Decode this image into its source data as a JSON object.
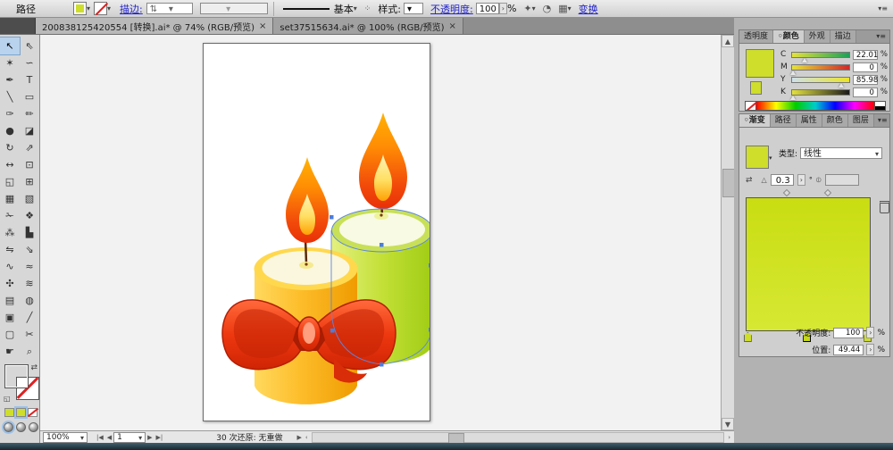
{
  "control_bar": {
    "context_label": "路径",
    "stroke_label": "描边:",
    "brush_value": "基本",
    "style_label": "样式:",
    "opacity_label": "不透明度:",
    "opacity_value": "100",
    "percent": "%",
    "transform_label": "变换",
    "icons": [
      {
        "name": "select-similar-icon",
        "glyph": "✦"
      },
      {
        "name": "document-setup-icon",
        "glyph": "◔"
      },
      {
        "name": "artboard-grid-icon",
        "glyph": "▦"
      }
    ]
  },
  "tabs": [
    {
      "title": "200838125420554 [转换].ai* @ 74% (RGB/预览)",
      "close": "×"
    },
    {
      "title": "set37515634.ai* @ 100% (RGB/预览)",
      "close": "×"
    }
  ],
  "tools": [
    {
      "name": "selection-tool",
      "glyph": "↖"
    },
    {
      "name": "direct-selection-tool",
      "glyph": "⇖"
    },
    {
      "name": "magic-wand-tool",
      "glyph": "✶"
    },
    {
      "name": "lasso-tool",
      "glyph": "∽"
    },
    {
      "name": "pen-tool",
      "glyph": "✒"
    },
    {
      "name": "type-tool",
      "glyph": "T"
    },
    {
      "name": "line-segment-tool",
      "glyph": "╲"
    },
    {
      "name": "rectangle-tool",
      "glyph": "▭"
    },
    {
      "name": "paintbrush-tool",
      "glyph": "✑"
    },
    {
      "name": "pencil-tool",
      "glyph": "✏"
    },
    {
      "name": "blob-brush-tool",
      "glyph": "●"
    },
    {
      "name": "eraser-tool",
      "glyph": "◪"
    },
    {
      "name": "rotate-tool",
      "glyph": "↻"
    },
    {
      "name": "scale-tool",
      "glyph": "⇗"
    },
    {
      "name": "width-tool",
      "glyph": "↔"
    },
    {
      "name": "free-transform-tool",
      "glyph": "⊡"
    },
    {
      "name": "shape-builder-tool",
      "glyph": "◱"
    },
    {
      "name": "perspective-grid-tool",
      "glyph": "⊞"
    },
    {
      "name": "mesh-tool",
      "glyph": "▦"
    },
    {
      "name": "gradient-tool",
      "glyph": "▧"
    },
    {
      "name": "eyedropper-tool",
      "glyph": "✁"
    },
    {
      "name": "blend-tool",
      "glyph": "❖"
    },
    {
      "name": "symbol-sprayer-tool",
      "glyph": "⁂"
    },
    {
      "name": "column-graph-tool",
      "glyph": "▙"
    },
    {
      "name": "reflect-tool",
      "glyph": "⇋"
    },
    {
      "name": "shear-tool",
      "glyph": "⇘"
    },
    {
      "name": "reshape-tool",
      "glyph": "∿"
    },
    {
      "name": "smooth-tool",
      "glyph": "≈"
    },
    {
      "name": "crystallize-tool",
      "glyph": "✣"
    },
    {
      "name": "wrinkle-tool",
      "glyph": "≋"
    },
    {
      "name": "envelope-mesh-tool",
      "glyph": "▤"
    },
    {
      "name": "live-paint-bucket-tool",
      "glyph": "◍"
    },
    {
      "name": "live-paint-selection-tool",
      "glyph": "▣"
    },
    {
      "name": "knife-tool",
      "glyph": "╱"
    },
    {
      "name": "artboard-tool",
      "glyph": "▢"
    },
    {
      "name": "slice-tool",
      "glyph": "✂"
    },
    {
      "name": "hand-tool",
      "glyph": "☛"
    },
    {
      "name": "zoom-tool",
      "glyph": "⌕"
    }
  ],
  "toolbox": {
    "fill_color": "#cede2b"
  },
  "color_panel": {
    "tabs": [
      "透明度",
      "颜色",
      "外观",
      "描边"
    ],
    "active_tab": "颜色",
    "swatch_color": "#cede2b",
    "channels": [
      {
        "label": "C",
        "value": "22.01",
        "pos": 22
      },
      {
        "label": "M",
        "value": "0",
        "pos": 2
      },
      {
        "label": "Y",
        "value": "85.98",
        "pos": 86
      },
      {
        "label": "K",
        "value": "0",
        "pos": 2
      }
    ],
    "unit": "%"
  },
  "gradient_panel": {
    "tabs": [
      "渐变",
      "路径",
      "属性",
      "颜色",
      "图层"
    ],
    "active_tab": "渐变",
    "type_label": "类型:",
    "type_value": "线性",
    "angle_value": "0.3",
    "degree": "°",
    "swatch_color": "#cede2b",
    "diamonds": [
      33,
      66
    ],
    "stops": [
      {
        "pos": 2,
        "selected": false
      },
      {
        "pos": 49.44,
        "selected": true
      },
      {
        "pos": 98,
        "selected": false
      }
    ],
    "opacity_label": "不透明度:",
    "opacity_value": "100",
    "location_label": "位置:",
    "location_value": "49.44",
    "unit": "%"
  },
  "status_bar": {
    "zoom_value": "100%",
    "artboard_value": "1",
    "status_text": "30 次还原: 无重做"
  },
  "artwork": {
    "flame_top": "#ffa306",
    "flame_bottom": "#ea3209",
    "inner_flame": "#ffe98a",
    "candle_orange_light": "#ffd95e",
    "candle_orange_dark": "#ef9b00",
    "candle_green_light": "#e4f07e",
    "candle_green_dark": "#9fcc14",
    "bow_red": "#e83414",
    "selection_blue": "#4a7ee0",
    "anchors": [
      [
        143,
        194
      ],
      [
        199,
        225
      ],
      [
        254,
        248
      ],
      [
        254,
        320
      ],
      [
        199,
        359
      ],
      [
        144,
        321
      ]
    ]
  }
}
